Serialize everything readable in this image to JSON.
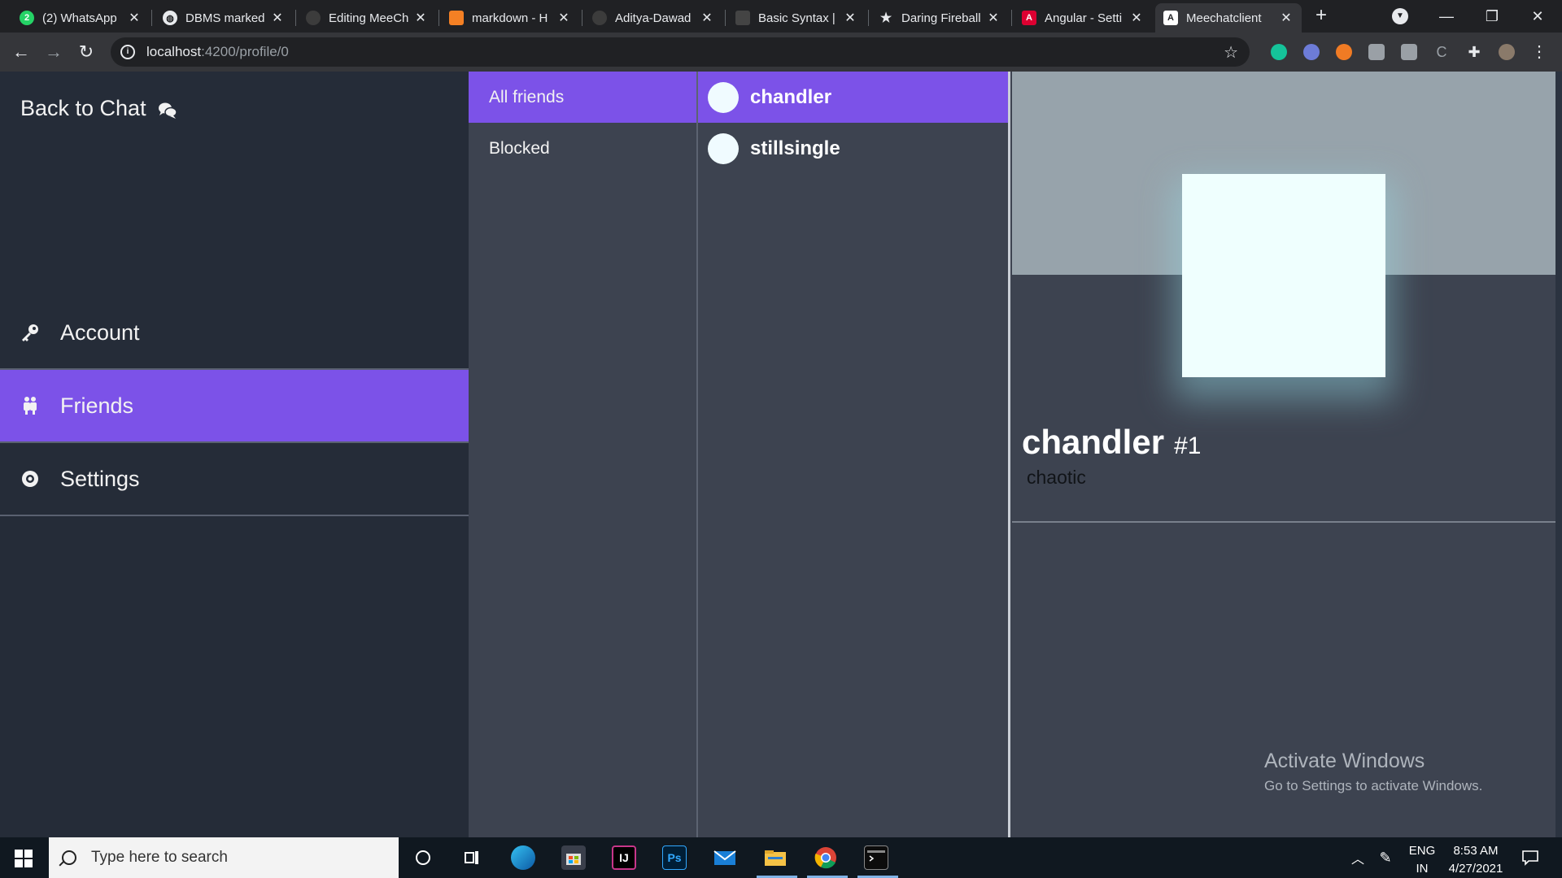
{
  "browser": {
    "tabs": [
      {
        "title": "(2) WhatsApp",
        "favicon": "whatsapp-icon",
        "color": "#25d366"
      },
      {
        "title": "DBMS marked",
        "favicon": "globe-icon",
        "color": "#e8eaed"
      },
      {
        "title": "Editing MeeCh",
        "favicon": "github-icon",
        "color": "#3c3c3c"
      },
      {
        "title": "markdown - H",
        "favicon": "stackoverflow-icon",
        "color": "#f48024"
      },
      {
        "title": "Aditya-Dawad",
        "favicon": "github-icon",
        "color": "#3c3c3c"
      },
      {
        "title": "Basic Syntax |",
        "favicon": "markdown-guide-icon",
        "color": "#444"
      },
      {
        "title": "Daring Fireball",
        "favicon": "star-icon",
        "color": "#e8eaed"
      },
      {
        "title": "Angular - Setti",
        "favicon": "angular-icon",
        "color": "#dd0031"
      },
      {
        "title": "Meechatclient",
        "favicon": "angular-icon",
        "color": "#ffffff"
      }
    ],
    "url_host": "localhost",
    "url_path": ":4200/profile/0"
  },
  "sidebar": {
    "back_label": "Back to Chat",
    "items": [
      {
        "label": "Account",
        "icon": "key-icon"
      },
      {
        "label": "Friends",
        "icon": "people-icon"
      },
      {
        "label": "Settings",
        "icon": "gear-icon"
      }
    ],
    "active_item": "Friends"
  },
  "filters": [
    {
      "label": "All friends",
      "active": true
    },
    {
      "label": "Blocked",
      "active": false
    }
  ],
  "friends": [
    {
      "name": "chandler",
      "active": true
    },
    {
      "name": "stillsingle",
      "active": false
    }
  ],
  "profile": {
    "name": "chandler",
    "tag": "#1",
    "status": "chaotic"
  },
  "watermark": {
    "line1": "Activate Windows",
    "line2": "Go to Settings to activate Windows."
  },
  "taskbar": {
    "search_placeholder": "Type here to search",
    "lang_top": "ENG",
    "lang_bottom": "IN",
    "time": "8:53 AM",
    "date": "4/27/2021"
  },
  "colors": {
    "accent": "#7c52e8",
    "sidebar_bg": "#252c38",
    "panel_bg": "#3d4350",
    "banner": "#97a3ab",
    "avatar": "#effffe"
  }
}
